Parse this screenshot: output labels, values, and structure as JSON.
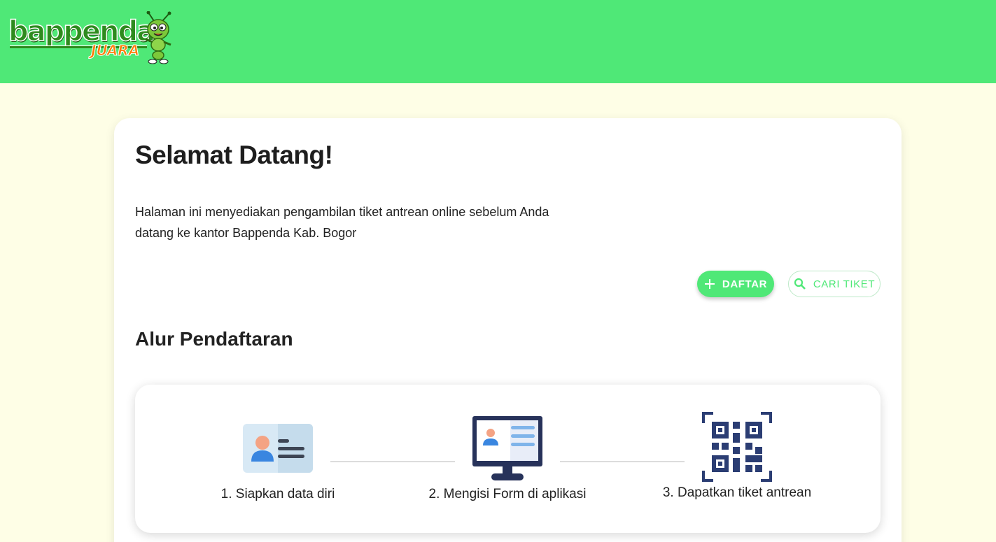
{
  "header": {
    "logo": {
      "brand": "bappenda",
      "tagline": "JUARA",
      "mascot_icon": "ant-mascot-icon"
    },
    "background_color": "#4fe877"
  },
  "welcome": {
    "title": "Selamat Datang!",
    "intro_line1": "Halaman ini menyediakan pengambilan tiket antrean online sebelum Anda",
    "intro_line2": "datang ke kantor Bappenda Kab. Bogor"
  },
  "actions": {
    "daftar": {
      "icon": "plus-icon",
      "label": "DAFTAR"
    },
    "cari_tiket": {
      "icon": "search-icon",
      "label": "CARI TIKET"
    }
  },
  "flow": {
    "title": "Alur Pendaftaran",
    "steps": [
      {
        "icon": "id-card-icon",
        "label": "1. Siapkan data diri"
      },
      {
        "icon": "monitor-form-icon",
        "label": "2. Mengisi Form di aplikasi"
      },
      {
        "icon": "qr-code-icon",
        "label": "3. Dapatkan tiket antrean"
      }
    ]
  },
  "colors": {
    "accent": "#4fe877",
    "page_background": "#fefee6",
    "card_background": "#ffffff"
  }
}
